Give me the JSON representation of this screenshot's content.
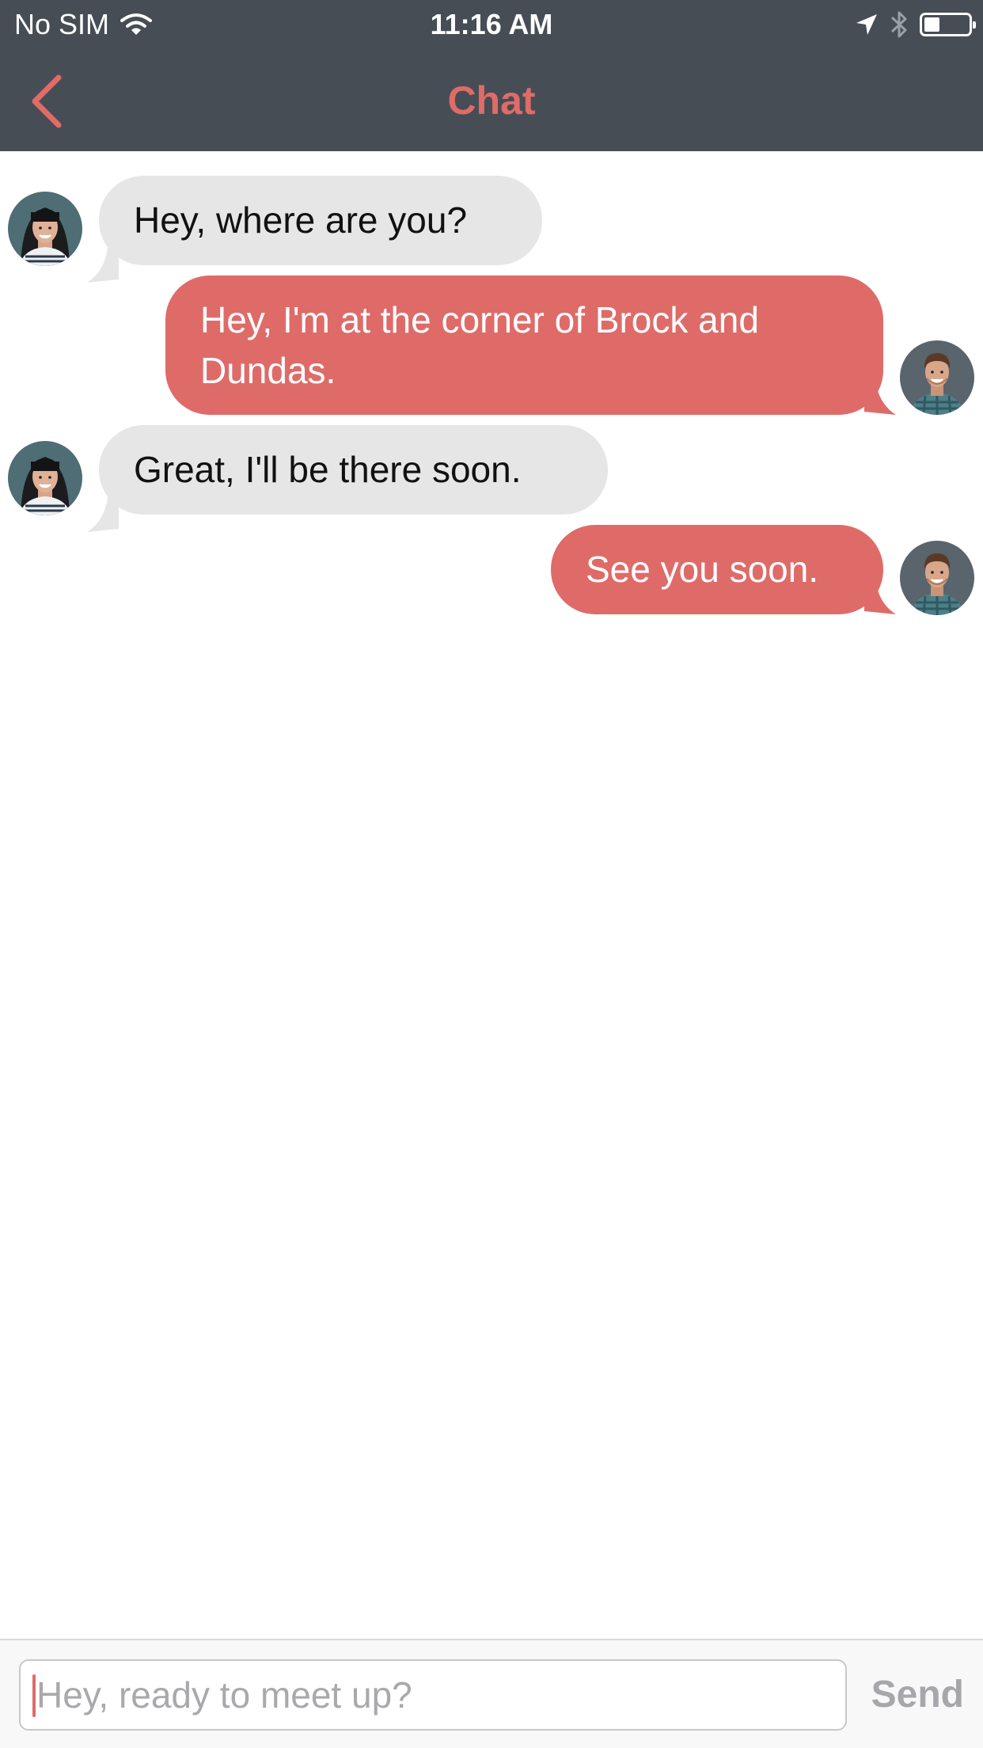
{
  "status_bar": {
    "carrier": "No SIM",
    "time": "11:16 AM",
    "battery_level": 0.35,
    "icons": [
      "wifi-icon",
      "location-arrow-icon",
      "bluetooth-icon",
      "battery-icon"
    ]
  },
  "nav": {
    "title": "Chat",
    "back_icon": "chevron-left-icon"
  },
  "messages": [
    {
      "sender": "other",
      "text": "Hey, where are you?"
    },
    {
      "sender": "me",
      "text": "Hey, I'm at the corner of Brock and Dundas."
    },
    {
      "sender": "other",
      "text": "Great, I'll be there soon."
    },
    {
      "sender": "me",
      "text": "See you soon."
    }
  ],
  "composer": {
    "placeholder": "Hey, ready to meet up?",
    "value": "",
    "send_label": "Send"
  },
  "colors": {
    "nav_background": "#474d55",
    "accent": "#df6b69",
    "incoming_bubble": "#e6e6e6",
    "send_disabled": "#a7a7ab"
  }
}
